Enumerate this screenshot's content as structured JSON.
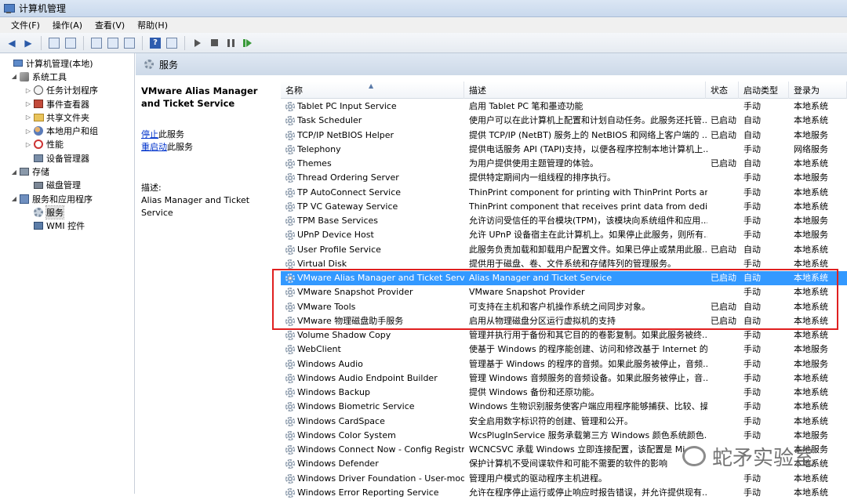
{
  "window": {
    "title": "计算机管理"
  },
  "menu": [
    "文件(F)",
    "操作(A)",
    "查看(V)",
    "帮助(H)"
  ],
  "tree": [
    {
      "label": "计算机管理(本地)",
      "level": 0,
      "exp": "",
      "icon": "computer-icon"
    },
    {
      "label": "系统工具",
      "level": 1,
      "exp": "◢",
      "icon": "tools-icon"
    },
    {
      "label": "任务计划程序",
      "level": 2,
      "exp": "▷",
      "icon": "clock-icon"
    },
    {
      "label": "事件查看器",
      "level": 2,
      "exp": "▷",
      "icon": "event-viewer-icon"
    },
    {
      "label": "共享文件夹",
      "level": 2,
      "exp": "▷",
      "icon": "folder-icon"
    },
    {
      "label": "本地用户和组",
      "level": 2,
      "exp": "▷",
      "icon": "users-icon"
    },
    {
      "label": "性能",
      "level": 2,
      "exp": "▷",
      "icon": "performance-icon"
    },
    {
      "label": "设备管理器",
      "level": 2,
      "exp": "",
      "icon": "device-manager-icon"
    },
    {
      "label": "存储",
      "level": 1,
      "exp": "◢",
      "icon": "storage-icon"
    },
    {
      "label": "磁盘管理",
      "level": 2,
      "exp": "",
      "icon": "disk-icon"
    },
    {
      "label": "服务和应用程序",
      "level": 1,
      "exp": "◢",
      "icon": "services-apps-icon"
    },
    {
      "label": "服务",
      "level": 2,
      "exp": "",
      "icon": "gear-icon",
      "selected": true
    },
    {
      "label": "WMI 控件",
      "level": 2,
      "exp": "",
      "icon": "wmi-icon"
    }
  ],
  "panel_title": "服务",
  "desc_pane": {
    "service_name": "VMware Alias Manager and Ticket Service",
    "stop_link": "停止",
    "stop_suffix": "此服务",
    "restart_link": "重启动",
    "restart_suffix": "此服务",
    "desc_label": "描述:",
    "desc_text": "Alias Manager and Ticket Service"
  },
  "columns": [
    "名称",
    "描述",
    "状态",
    "启动类型",
    "登录为"
  ],
  "rows": [
    {
      "name": "Tablet PC Input Service",
      "desc": "启用 Tablet PC 笔和墨迹功能",
      "status": "",
      "startup": "手动",
      "logon": "本地系统"
    },
    {
      "name": "Task Scheduler",
      "desc": "使用户可以在此计算机上配置和计划自动任务。此服务还托管...",
      "status": "已启动",
      "startup": "自动",
      "logon": "本地系统"
    },
    {
      "name": "TCP/IP NetBIOS Helper",
      "desc": "提供 TCP/IP (NetBT) 服务上的 NetBIOS 和网络上客户端的 ...",
      "status": "已启动",
      "startup": "自动",
      "logon": "本地服务"
    },
    {
      "name": "Telephony",
      "desc": "提供电话服务 API (TAPI)支持，以便各程序控制本地计算机上...",
      "status": "",
      "startup": "手动",
      "logon": "网络服务"
    },
    {
      "name": "Themes",
      "desc": "为用户提供使用主题管理的体验。",
      "status": "已启动",
      "startup": "自动",
      "logon": "本地系统"
    },
    {
      "name": "Thread Ordering Server",
      "desc": "提供特定期间内一组线程的排序执行。",
      "status": "",
      "startup": "手动",
      "logon": "本地服务"
    },
    {
      "name": "TP AutoConnect Service",
      "desc": "ThinPrint component for printing with ThinPrint Ports and...",
      "status": "",
      "startup": "手动",
      "logon": "本地系统"
    },
    {
      "name": "TP VC Gateway Service",
      "desc": "ThinPrint component that receives print data from dedica...",
      "status": "",
      "startup": "手动",
      "logon": "本地系统"
    },
    {
      "name": "TPM Base Services",
      "desc": "允许访问受信任的平台模块(TPM)，该模块向系统组件和应用...",
      "status": "",
      "startup": "手动",
      "logon": "本地服务"
    },
    {
      "name": "UPnP Device Host",
      "desc": "允许 UPnP 设备宿主在此计算机上。如果停止此服务，则所有...",
      "status": "",
      "startup": "手动",
      "logon": "本地服务"
    },
    {
      "name": "User Profile Service",
      "desc": "此服务负责加载和卸载用户配置文件。如果已停止或禁用此服...",
      "status": "已启动",
      "startup": "自动",
      "logon": "本地系统"
    },
    {
      "name": "Virtual Disk",
      "desc": "提供用于磁盘、卷、文件系统和存储阵列的管理服务。",
      "status": "",
      "startup": "手动",
      "logon": "本地系统"
    },
    {
      "name": "VMware Alias Manager and Ticket Servi...",
      "desc": "Alias Manager and Ticket Service",
      "status": "已启动",
      "startup": "自动",
      "logon": "本地系统",
      "selected": true
    },
    {
      "name": "VMware Snapshot Provider",
      "desc": "VMware Snapshot Provider",
      "status": "",
      "startup": "手动",
      "logon": "本地系统"
    },
    {
      "name": "VMware Tools",
      "desc": "可支持在主机和客户机操作系统之间同步对象。",
      "status": "已启动",
      "startup": "自动",
      "logon": "本地系统"
    },
    {
      "name": "VMware 物理磁盘助手服务",
      "desc": "启用从物理磁盘分区运行虚拟机的支持",
      "status": "已启动",
      "startup": "自动",
      "logon": "本地系统"
    },
    {
      "name": "Volume Shadow Copy",
      "desc": "管理并执行用于备份和其它目的的卷影复制。如果此服务被终...",
      "status": "",
      "startup": "手动",
      "logon": "本地系统"
    },
    {
      "name": "WebClient",
      "desc": "使基于 Windows 的程序能创建、访问和修改基于 Internet 的...",
      "status": "",
      "startup": "手动",
      "logon": "本地服务"
    },
    {
      "name": "Windows Audio",
      "desc": "管理基于 Windows 的程序的音频。如果此服务被停止，音频...",
      "status": "",
      "startup": "手动",
      "logon": "本地服务"
    },
    {
      "name": "Windows Audio Endpoint Builder",
      "desc": "管理 Windows 音频服务的音频设备。如果此服务被停止，音...",
      "status": "",
      "startup": "手动",
      "logon": "本地系统"
    },
    {
      "name": "Windows Backup",
      "desc": "提供 Windows 备份和还原功能。",
      "status": "",
      "startup": "手动",
      "logon": "本地系统"
    },
    {
      "name": "Windows Biometric Service",
      "desc": "Windows 生物识别服务使客户端应用程序能够捕获、比较、操...",
      "status": "",
      "startup": "手动",
      "logon": "本地系统"
    },
    {
      "name": "Windows CardSpace",
      "desc": "安全启用数字标识符的创建、管理和公开。",
      "status": "",
      "startup": "手动",
      "logon": "本地系统"
    },
    {
      "name": "Windows Color System",
      "desc": "WcsPlugInService 服务承载第三方 Windows 颜色系统颜色...",
      "status": "",
      "startup": "手动",
      "logon": "本地服务"
    },
    {
      "name": "Windows Connect Now - Config Registrar",
      "desc": "WCNCSVC 承载 Windows 立即连接配置，该配置是 Mi",
      "status": "",
      "startup": "",
      "logon": "本地服务"
    },
    {
      "name": "Windows Defender",
      "desc": "保护计算机不受间谍软件和可能不需要的软件的影响",
      "status": "",
      "startup": "",
      "logon": "本地系统"
    },
    {
      "name": "Windows Driver Foundation - User-mod...",
      "desc": "管理用户模式的驱动程序主机进程。",
      "status": "",
      "startup": "手动",
      "logon": "本地系统"
    },
    {
      "name": "Windows Error Reporting Service",
      "desc": "允许在程序停止运行或停止响应时报告错误，并允许提供现有...",
      "status": "",
      "startup": "手动",
      "logon": "本地系统"
    }
  ],
  "watermark": "蛇矛实验室"
}
